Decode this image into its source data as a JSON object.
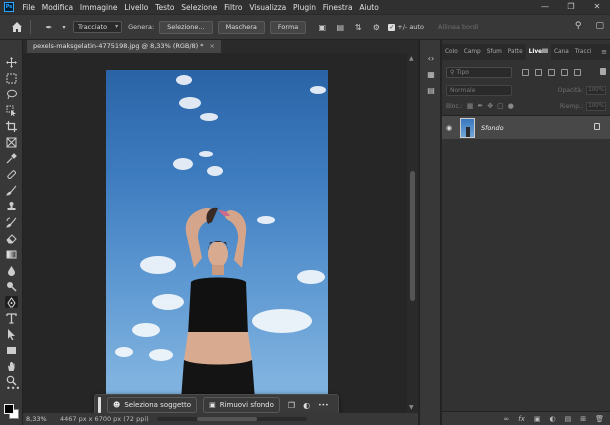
{
  "app": {
    "logo_text": "Ps"
  },
  "menu": [
    "File",
    "Modifica",
    "Immagine",
    "Livello",
    "Testo",
    "Selezione",
    "Filtro",
    "Visualizza",
    "Plugin",
    "Finestra",
    "Aiuto"
  ],
  "window_controls": [
    "—",
    "❐",
    "✕"
  ],
  "options_bar": {
    "mode_select": "Tracciato",
    "genera_label": "Genera:",
    "selezione_button": "Selezione...",
    "maschera_button": "Maschera",
    "forma_button": "Forma",
    "auto_label": "+/- auto",
    "allinea_label": "Allinea bordi"
  },
  "document": {
    "tab_title": "pexels-maksgelatin-4775198.jpg @ 8,33% (RGB/8) *",
    "tab_close": "×",
    "zoom": "8,33%",
    "dimensions": "4467 px x 6700 px (72 ppi)"
  },
  "context_bar": {
    "select_subject": "Seleziona soggetto",
    "remove_background": "Rimuovi sfondo",
    "more": "•••"
  },
  "panel": {
    "tabs": [
      "Colo",
      "Camp",
      "Sfum",
      "Patte",
      "Livelli",
      "Cana",
      "Tracci"
    ],
    "active_tab": "Livelli",
    "filter_placeholder": "Tipo",
    "blend_mode": "Normale",
    "opacity_label": "Opacità:",
    "opacity_value": "100%",
    "lock_label": "Bloc.:",
    "fill_label": "Riemp.:",
    "fill_value": "100%"
  },
  "layers": [
    {
      "name": "Sfondo",
      "visible": true,
      "locked": true
    }
  ],
  "colors": {
    "accent": "#31a8ff",
    "sky": "#3d7bbf",
    "panel_bg": "#323232",
    "canvas_bg": "#262626"
  }
}
